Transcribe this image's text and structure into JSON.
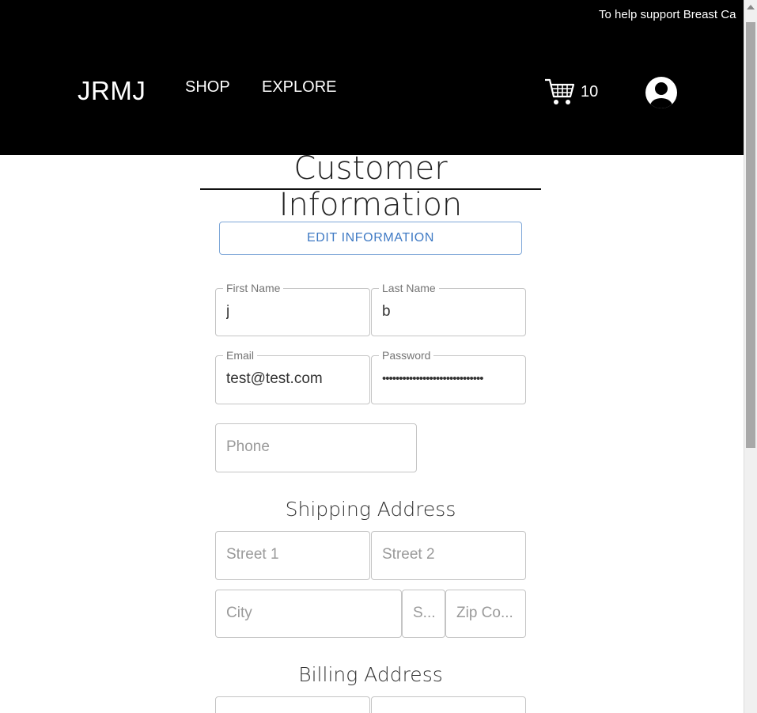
{
  "header": {
    "promo": "To help support Breast Ca",
    "brand": "JRMJ",
    "nav": {
      "shop": "SHOP",
      "explore": "EXPLORE"
    },
    "cart_count": "10"
  },
  "main": {
    "title": "Customer Information",
    "edit_button": "EDIT INFORMATION",
    "fields": {
      "first_name": {
        "label": "First Name",
        "value": "j"
      },
      "last_name": {
        "label": "Last Name",
        "value": "b"
      },
      "email": {
        "label": "Email",
        "value": "test@test.com"
      },
      "password": {
        "label": "Password",
        "value": "••••••••••••••••••••••••••••••"
      },
      "phone": {
        "placeholder": "Phone"
      }
    },
    "shipping": {
      "heading": "Shipping Address",
      "street1": "Street 1",
      "street2": "Street 2",
      "city": "City",
      "state": "S...",
      "zip": "Zip Co..."
    },
    "billing": {
      "heading": "Billing Address"
    }
  },
  "colors": {
    "header_bg": "#000000",
    "accent": "#3f7ac4",
    "field_border": "#c4c4c4"
  }
}
